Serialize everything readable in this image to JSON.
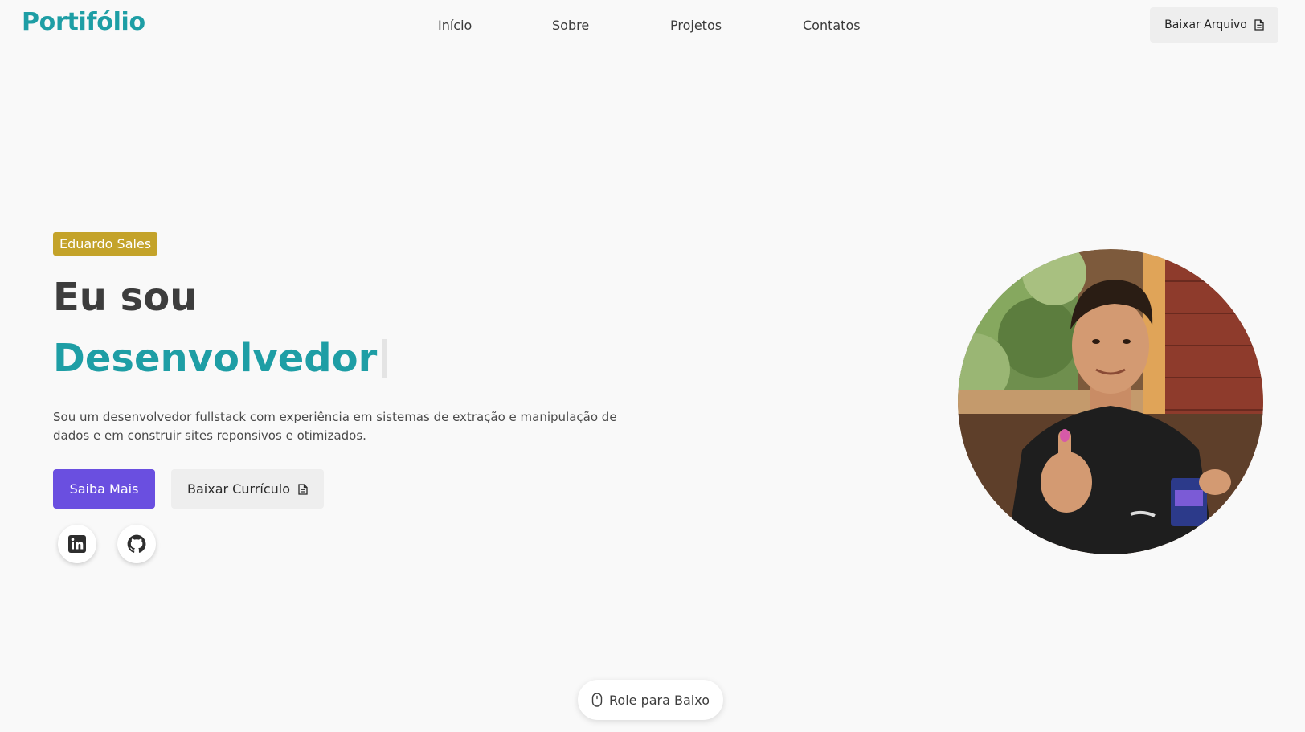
{
  "header": {
    "logo": "Portifólio",
    "nav": [
      "Início",
      "Sobre",
      "Projetos",
      "Contatos"
    ],
    "download_label": "Baixar Arquivo",
    "download_icon": "file-icon"
  },
  "hero": {
    "name_badge": "Eduardo Sales",
    "title_line1": "Eu sou",
    "title_line2": "Desenvolvedor",
    "description": "Sou um desenvolvedor fullstack com experiência em sistemas de extração e manipulação de dados e em construir sites reponsivos e otimizados.",
    "primary_button": "Saiba Mais",
    "secondary_button": "Baixar Currículo",
    "secondary_icon": "file-icon",
    "social": [
      "linkedin-icon",
      "github-icon"
    ]
  },
  "photo": {
    "icon": "profile-photo"
  },
  "scroll": {
    "label": "Role para Baixo",
    "icon": "mouse-icon"
  },
  "colors": {
    "accent": "#1e9ea5",
    "primary_button": "#6a4fe0",
    "badge": "#c4a32a",
    "background": "#f9f9f9"
  }
}
